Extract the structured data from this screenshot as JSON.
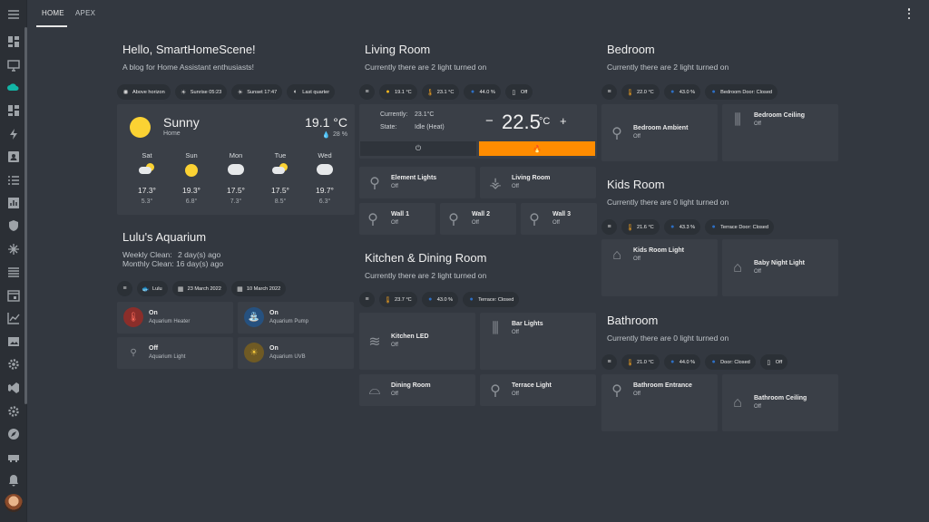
{
  "tabs": [
    {
      "label": "HOME"
    },
    {
      "label": "APEX"
    }
  ],
  "welcome": {
    "title": "Hello, SmartHomeScene!",
    "subtitle": "A blog for Home Assistant enthusiasts!",
    "chips": [
      "Above horizon",
      "Sunrise 05:23",
      "Sunset 17:47",
      "Last quarter"
    ]
  },
  "weather": {
    "condition": "Sunny",
    "location": "Home",
    "temp": "19.1 °C",
    "humidity": "28 %",
    "forecast": [
      {
        "day": "Sat",
        "hi": "17.3°",
        "lo": "5.3°",
        "icon": "partly-cloudy"
      },
      {
        "day": "Sun",
        "hi": "19.3°",
        "lo": "6.8°",
        "icon": "sunny"
      },
      {
        "day": "Mon",
        "hi": "17.5°",
        "lo": "7.3°",
        "icon": "cloudy"
      },
      {
        "day": "Tue",
        "hi": "17.5°",
        "lo": "8.5°",
        "icon": "partly-cloudy"
      },
      {
        "day": "Wed",
        "hi": "19.7°",
        "lo": "6.3°",
        "icon": "cloudy"
      }
    ]
  },
  "aquarium": {
    "title": "Lulu's Aquarium",
    "weekly_label": "Weekly Clean:",
    "weekly_value": "2 day(s) ago",
    "monthly_label": "Monthly Clean:",
    "monthly_value": "16 day(s) ago",
    "chips": [
      "Lulu",
      "23 March 2022",
      "10 March 2022"
    ],
    "tiles": [
      {
        "state": "On",
        "name": "Aquarium Heater",
        "color": "#c0392b"
      },
      {
        "state": "On",
        "name": "Aquarium Pump",
        "color": "#2e6fb3"
      },
      {
        "state": "Off",
        "name": "Aquarium Light",
        "color": ""
      },
      {
        "state": "On",
        "name": "Aquarium UVB",
        "color": "#e0a82e"
      }
    ]
  },
  "living": {
    "title": "Living Room",
    "subtitle": "Currently there are 2 light turned on",
    "chips": [
      "19.1 °C",
      "23.1 °C",
      "44.0 %",
      "Off"
    ],
    "thermostat": {
      "currently_label": "Currently:",
      "currently_value": "23.1°C",
      "state_label": "State:",
      "state_value": "Idle (Heat)",
      "minus": "−",
      "target": "22.5",
      "unit": "°C",
      "plus": "+",
      "accent": "#ff8c00"
    },
    "tiles": [
      {
        "name": "Element Lights",
        "state": "Off"
      },
      {
        "name": "Living Room",
        "state": "Off"
      },
      {
        "name": "Wall 1",
        "state": "Off"
      },
      {
        "name": "Wall 2",
        "state": "Off"
      },
      {
        "name": "Wall 3",
        "state": "Off"
      }
    ]
  },
  "kitchen": {
    "title": "Kitchen & Dining Room",
    "subtitle": "Currently there are 2 light turned on",
    "chips": [
      "23.7 °C",
      "43.0 %",
      "Terrace: Closed"
    ],
    "tiles": [
      {
        "name": "Kitchen LED",
        "state": "Off"
      },
      {
        "name": "Bar Lights",
        "state": "Off"
      },
      {
        "name": "Dining Room",
        "state": "Off"
      },
      {
        "name": "Terrace Light",
        "state": "Off"
      }
    ]
  },
  "bedroom": {
    "title": "Bedroom",
    "subtitle": "Currently there are 2 light turned on",
    "chips": [
      "22.0 °C",
      "43.0 %",
      "Bedroom Door: Closed"
    ],
    "tiles": [
      {
        "name": "Bedroom Ambient",
        "state": "Off"
      },
      {
        "name": "Bedroom Ceiling",
        "state": "Off"
      }
    ]
  },
  "kids": {
    "title": "Kids Room",
    "subtitle": "Currently there are 0 light turned on",
    "chips": [
      "21.6 °C",
      "43.3 %",
      "Terrace Door: Closed"
    ],
    "tiles": [
      {
        "name": "Kids Room Light",
        "state": "Off"
      },
      {
        "name": "Baby Night Light",
        "state": "Off"
      }
    ]
  },
  "bathroom": {
    "title": "Bathroom",
    "subtitle": "Currently there are 0 light turned on",
    "chips": [
      "21.0 °C",
      "44.0 %",
      "Door: Closed",
      "Off"
    ],
    "tiles": [
      {
        "name": "Bathroom Entrance",
        "state": "Off"
      },
      {
        "name": "Bathroom Ceiling",
        "state": "Off"
      }
    ]
  }
}
